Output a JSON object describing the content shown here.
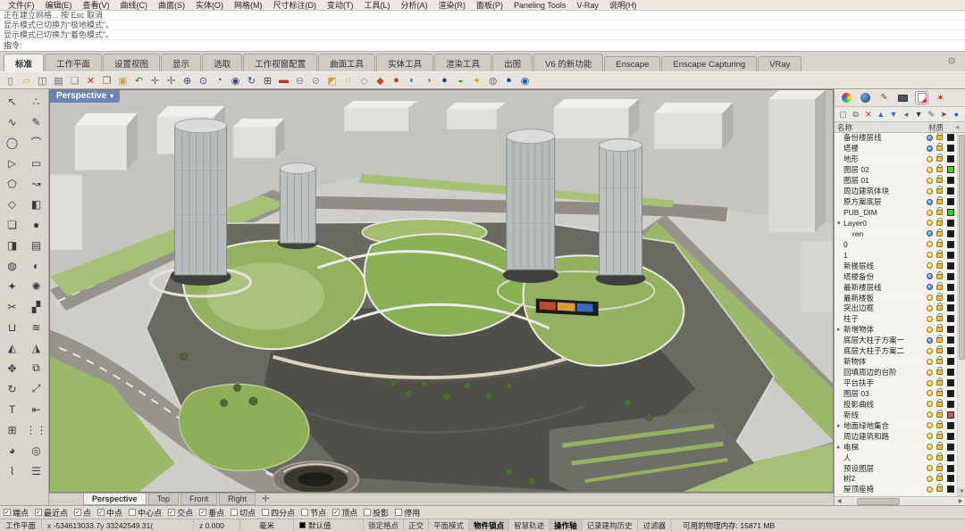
{
  "menu": {
    "items": [
      "文件(F)",
      "编辑(E)",
      "查看(V)",
      "曲线(C)",
      "曲面(S)",
      "实体(O)",
      "网格(M)",
      "尺寸标注(D)",
      "变动(T)",
      "工具(L)",
      "分析(A)",
      "渲染(R)",
      "面板(P)",
      "Paneling Tools",
      "V-Ray",
      "说明(H)"
    ]
  },
  "command_history": {
    "lines": [
      "正在建立网格... 按 Esc 取消",
      "显示模式已切换为“极地模式”。",
      "显示模式已切换为“着色模式”。"
    ],
    "prompt": "指令:"
  },
  "toolbar_tabs": {
    "active": "标准",
    "items": [
      "标准",
      "工作平面",
      "设置视图",
      "显示",
      "选取",
      "工作视窗配置",
      "曲面工具",
      "实体工具",
      "渲染工具",
      "出图",
      "V6 的新功能",
      "Enscape",
      "Enscape Capturing",
      "VRay"
    ]
  },
  "main_toolbar_icons": [
    {
      "name": "new-file-icon",
      "g": "▯",
      "c": "#666666"
    },
    {
      "name": "open-file-icon",
      "g": "▱",
      "c": "#d8a43c"
    },
    {
      "name": "save-icon",
      "g": "◫",
      "c": "#3a66a8"
    },
    {
      "name": "print-icon",
      "g": "▤",
      "c": "#666666"
    },
    {
      "name": "properties-icon",
      "g": "❏",
      "c": "#888888"
    },
    {
      "name": "delete-icon",
      "g": "✕",
      "c": "#bb3333"
    },
    {
      "name": "copy-icon",
      "g": "❐",
      "c": "#666666"
    },
    {
      "name": "paste-icon",
      "g": "▣",
      "c": "#c8a43c"
    },
    {
      "name": "undo-icon",
      "g": "↶",
      "c": "#338833"
    },
    {
      "name": "pan-icon",
      "g": "✛",
      "c": "#666666"
    },
    {
      "name": "move-icon",
      "g": "✢",
      "c": "#666666"
    },
    {
      "name": "zoom-icon",
      "g": "⊕",
      "c": "#334a88"
    },
    {
      "name": "zoom-window-icon",
      "g": "⊙",
      "c": "#334a88"
    },
    {
      "name": "zoom-extents-icon",
      "g": "◔",
      "c": "#334a88"
    },
    {
      "name": "zoom-selected-icon",
      "g": "◉",
      "c": "#334a88"
    },
    {
      "name": "rotate-view-icon",
      "g": "↻",
      "c": "#334a88"
    },
    {
      "name": "viewport-layout-icon",
      "g": "⊞",
      "c": "#444455"
    },
    {
      "name": "hide-icon",
      "g": "▬",
      "c": "#bb3333"
    },
    {
      "name": "zoom-out-icon",
      "g": "⊖",
      "c": "#888888"
    },
    {
      "name": "no-clip-icon",
      "g": "⊘",
      "c": "#888888"
    },
    {
      "name": "layer-state-icon",
      "g": "◩",
      "c": "#c8a43c"
    },
    {
      "name": "lightbulb-icon",
      "g": "○",
      "c": "#ddbb00"
    },
    {
      "name": "lock-icon",
      "g": "◇",
      "c": "#888888"
    },
    {
      "name": "shade-icon",
      "g": "◆",
      "c": "#cc4422"
    },
    {
      "name": "render-icon",
      "g": "●",
      "c": "#cc3322"
    },
    {
      "name": "rendered-view-icon",
      "g": "◐",
      "c": "#2277cc"
    },
    {
      "name": "ghosted-view-icon",
      "g": "◑",
      "c": "#888888"
    },
    {
      "name": "raytrace-icon",
      "g": "●",
      "c": "#224488"
    },
    {
      "name": "material-icon",
      "g": "◒",
      "c": "#33aa33"
    },
    {
      "name": "sun-icon",
      "g": "✦",
      "c": "#ddaa00"
    },
    {
      "name": "environment-icon",
      "g": "◍",
      "c": "#777777"
    },
    {
      "name": "earth-icon",
      "g": "●",
      "c": "#2255aa"
    },
    {
      "name": "help-sphere-icon",
      "g": "◉",
      "c": "#1166bb"
    }
  ],
  "tool_palette_icons": [
    {
      "name": "select-arrow-icon",
      "g": "↖"
    },
    {
      "name": "select-points-icon",
      "g": "∴"
    },
    {
      "name": "curve-icon",
      "g": "∿"
    },
    {
      "name": "control-point-curve-icon",
      "g": "✎"
    },
    {
      "name": "circle-icon",
      "g": "◯"
    },
    {
      "name": "arc-icon",
      "g": "⌒"
    },
    {
      "name": "polyline-icon",
      "g": "▷"
    },
    {
      "name": "rectangle-icon",
      "g": "▭"
    },
    {
      "name": "polygon-icon",
      "g": "⬠"
    },
    {
      "name": "freeform-icon",
      "g": "↝"
    },
    {
      "name": "surface-icon",
      "g": "◇"
    },
    {
      "name": "surface-corner-icon",
      "g": "◧"
    },
    {
      "name": "box-icon",
      "g": "❏"
    },
    {
      "name": "sphere-icon",
      "g": "●"
    },
    {
      "name": "extrude-icon",
      "g": "◨"
    },
    {
      "name": "loft-icon",
      "g": "▤"
    },
    {
      "name": "boolean-union-icon",
      "g": "◍"
    },
    {
      "name": "boolean-diff-icon",
      "g": "◐"
    },
    {
      "name": "fillet-icon",
      "g": "✦"
    },
    {
      "name": "explode-icon",
      "g": "✺"
    },
    {
      "name": "trim-icon",
      "g": "✂"
    },
    {
      "name": "split-icon",
      "g": "▞"
    },
    {
      "name": "join-icon",
      "g": "⊔"
    },
    {
      "name": "offset-icon",
      "g": "≋"
    },
    {
      "name": "curve-boolean-icon",
      "g": "◭"
    },
    {
      "name": "blend-icon",
      "g": "◮"
    },
    {
      "name": "move-tool-icon",
      "g": "✥"
    },
    {
      "name": "copy-tool-icon",
      "g": "⧉"
    },
    {
      "name": "rotate-tool-icon",
      "g": "↻"
    },
    {
      "name": "scale-tool-icon",
      "g": "⤢"
    },
    {
      "name": "text-icon",
      "g": "T"
    },
    {
      "name": "dimension-icon",
      "g": "⇤"
    },
    {
      "name": "group-icon",
      "g": "⊞"
    },
    {
      "name": "array-icon",
      "g": "⋮⋮"
    },
    {
      "name": "sphere-solid-icon",
      "g": "◕"
    },
    {
      "name": "torus-icon",
      "g": "◎"
    },
    {
      "name": "pipe-icon",
      "g": "⌇"
    },
    {
      "name": "grid-icon",
      "g": "☰"
    }
  ],
  "viewport": {
    "label": "Perspective",
    "tabs": [
      "Perspective",
      "Top",
      "Front",
      "Right"
    ],
    "active_tab": "Perspective",
    "new_tab_icon": "✛",
    "scene_palette": {
      "ground": "#cfcdc8",
      "road": "#96948d",
      "grass": "#93b15e",
      "deck": "#504f4a",
      "tower_glass": "#b7bdbd"
    }
  },
  "layers_panel": {
    "tabs": [
      "display-properties-tab",
      "render-properties-tab",
      "material-tab",
      "display-mode-tab",
      "layers-tab",
      "plugin-tab"
    ],
    "active_tab_index": 4,
    "toolbar": [
      {
        "name": "new-layer-icon",
        "g": "▢",
        "c": "#555"
      },
      {
        "name": "new-sublayer-icon",
        "g": "⧉",
        "c": "#555"
      },
      {
        "name": "delete-layer-icon",
        "g": "✕",
        "c": "#c22"
      },
      {
        "name": "move-up-icon",
        "g": "▲",
        "c": "#36c"
      },
      {
        "name": "move-down-icon",
        "g": "▼",
        "c": "#36c"
      },
      {
        "name": "collapse-icon",
        "g": "◂",
        "c": "#555"
      },
      {
        "name": "filter-icon",
        "g": "▼",
        "c": "#333"
      },
      {
        "name": "match-icon",
        "g": "✎",
        "c": "#555"
      },
      {
        "name": "select-objects-icon",
        "g": "➤",
        "c": "#555"
      },
      {
        "name": "help-icon",
        "g": "●",
        "c": "#26c"
      }
    ],
    "columns": {
      "name": "名称",
      "material": "材质"
    },
    "layers": [
      {
        "name": "备份楼层线",
        "bulb": "off",
        "swatch": "#1a1a1a"
      },
      {
        "name": "塔楼",
        "bulb": "off",
        "swatch": "#1a1a1a"
      },
      {
        "name": "地形",
        "bulb": "on",
        "swatch": "#1a1a1a"
      },
      {
        "name": "图层 02",
        "bulb": "on",
        "swatch": "#55c82e"
      },
      {
        "name": "图层 01",
        "bulb": "on",
        "swatch": "#1a1a1a"
      },
      {
        "name": "周边建筑体块",
        "bulb": "on",
        "swatch": "#1a1a1a"
      },
      {
        "name": "原方案底层",
        "bulb": "off",
        "swatch": "#1a1a1a"
      },
      {
        "name": "PUB_DIM",
        "bulb": "on",
        "swatch": "#2ed41c"
      },
      {
        "name": "Layer0",
        "bulb": "on",
        "swatch": "#1a1a1a",
        "expand": "down"
      },
      {
        "name": "ren",
        "bulb": "off",
        "swatch": "#1a1a1a",
        "indent": 1
      },
      {
        "name": "0",
        "bulb": "on",
        "swatch": "#1a1a1a"
      },
      {
        "name": "1",
        "bulb": "on",
        "swatch": "#1a1a1a"
      },
      {
        "name": "新楼层线",
        "bulb": "on",
        "swatch": "#1a1a1a"
      },
      {
        "name": "塔楼备份",
        "bulb": "off",
        "swatch": "#1a1a1a"
      },
      {
        "name": "最新楼层线",
        "bulb": "off",
        "swatch": "#1a1a1a"
      },
      {
        "name": "最新楼板",
        "bulb": "on",
        "swatch": "#1a1a1a"
      },
      {
        "name": "突出边框",
        "bulb": "on",
        "swatch": "#1a1a1a"
      },
      {
        "name": "柱子",
        "bulb": "on",
        "swatch": "#1a1a1a"
      },
      {
        "name": "新增物体",
        "bulb": "on",
        "swatch": "#1a1a1a",
        "expand": "right"
      },
      {
        "name": "底层大柱子方案一",
        "bulb": "off",
        "swatch": "#1a1a1a"
      },
      {
        "name": "底层大柱子方案二",
        "bulb": "on",
        "swatch": "#1a1a1a"
      },
      {
        "name": "新物体",
        "bulb": "on",
        "swatch": "#1a1a1a"
      },
      {
        "name": "回填周边的台阶",
        "bulb": "on",
        "swatch": "#1a1a1a"
      },
      {
        "name": "平台扶手",
        "bulb": "on",
        "swatch": "#1a1a1a"
      },
      {
        "name": "图层 03",
        "bulb": "on",
        "swatch": "#1a1a1a"
      },
      {
        "name": "投影曲线",
        "bulb": "on",
        "swatch": "#1a1a1a"
      },
      {
        "name": "新线",
        "bulb": "on",
        "swatch": "#b4635a"
      },
      {
        "name": "地面绿地集合",
        "bulb": "on",
        "swatch": "#1a1a1a",
        "expand": "right"
      },
      {
        "name": "周边建筑和路",
        "bulb": "on",
        "swatch": "#1a1a1a"
      },
      {
        "name": "电梯",
        "bulb": "on",
        "swatch": "#1a1a1a",
        "expand": "right"
      },
      {
        "name": "人",
        "bulb": "on",
        "swatch": "#1a1a1a"
      },
      {
        "name": "预设图层",
        "bulb": "on",
        "swatch": "#1a1a1a"
      },
      {
        "name": "树2",
        "bulb": "on",
        "swatch": "#1a1a1a"
      },
      {
        "name": "屋顶座椅",
        "bulb": "on",
        "swatch": "#1a1a1a"
      }
    ]
  },
  "osnap": {
    "items": [
      {
        "label": "端点",
        "checked": true
      },
      {
        "label": "最近点",
        "checked": true
      },
      {
        "label": "点",
        "checked": true
      },
      {
        "label": "中点",
        "checked": true
      },
      {
        "label": "中心点",
        "checked": false
      },
      {
        "label": "交点",
        "checked": true
      },
      {
        "label": "垂点",
        "checked": true
      },
      {
        "label": "切点",
        "checked": false
      },
      {
        "label": "四分点",
        "checked": false
      },
      {
        "label": "节点",
        "checked": false
      },
      {
        "label": "顶点",
        "checked": true
      },
      {
        "label": "投影",
        "checked": false
      },
      {
        "label": "停用",
        "checked": false
      }
    ]
  },
  "status_bar": {
    "cplane_label": "工作平面",
    "coords_xy": "x -534613033.7y 33242549.31(",
    "coord_z": "z 0.000",
    "units": "毫米",
    "layer_indicator": "默认值",
    "layer_indicator_color": "#000000",
    "toggles": [
      {
        "label": "锁定格点",
        "active": false
      },
      {
        "label": "正交",
        "active": false
      },
      {
        "label": "平面模式",
        "active": false
      },
      {
        "label": "物件锁点",
        "active": true
      },
      {
        "label": "智慧轨迹",
        "active": false
      },
      {
        "label": "操作轴",
        "active": true
      },
      {
        "label": "记录建构历史",
        "active": false
      }
    ],
    "filter_label": "过滤器",
    "memory_label": "可用的物理内存: 15871 MB"
  }
}
